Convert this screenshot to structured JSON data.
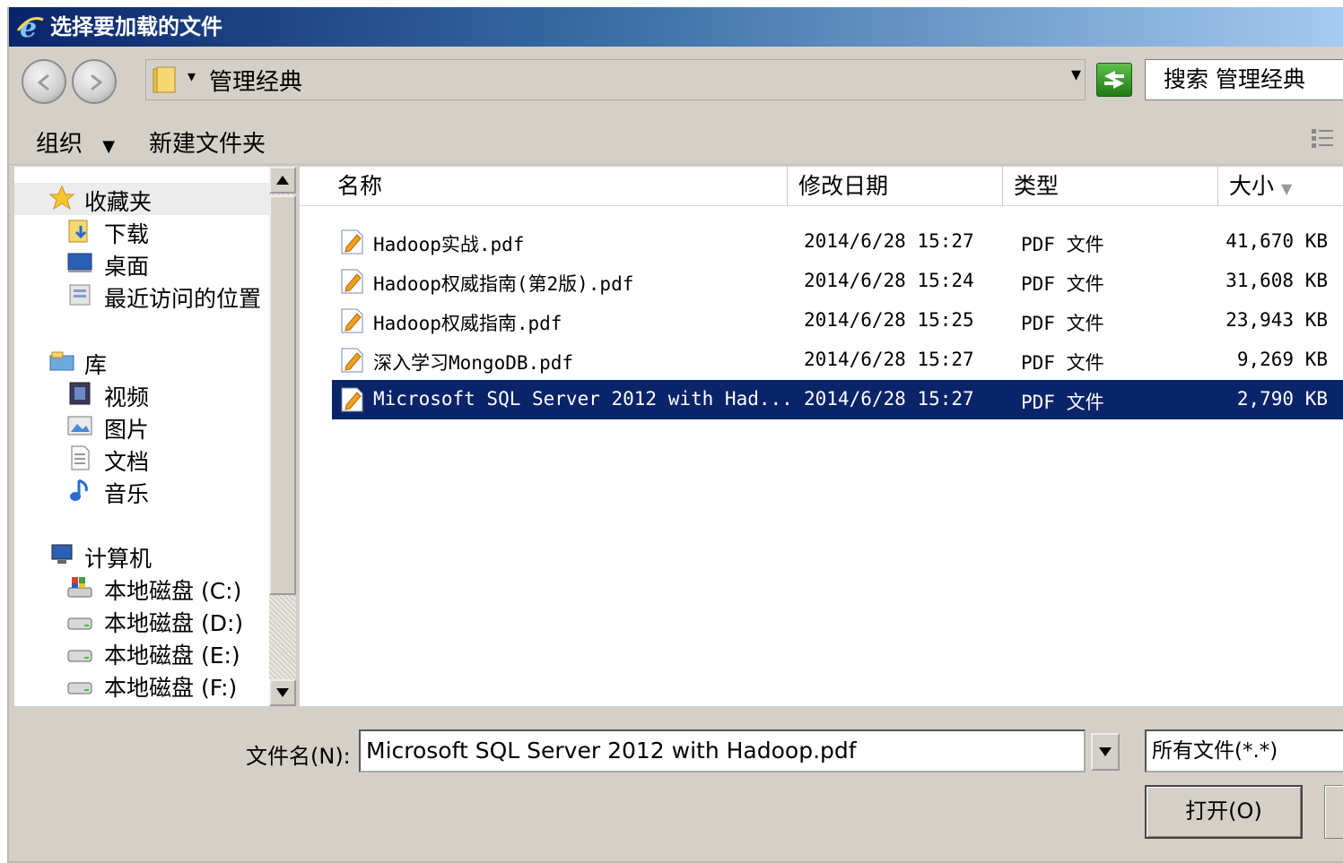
{
  "window": {
    "title": "选择要加载的文件"
  },
  "address": {
    "path": "管理经典",
    "search_placeholder": "搜索 管理经典"
  },
  "toolbar": {
    "organize": "组织",
    "new_folder": "新建文件夹"
  },
  "nav": {
    "favorites": {
      "label": "收藏夹",
      "items": [
        "下载",
        "桌面",
        "最近访问的位置"
      ]
    },
    "libraries": {
      "label": "库",
      "items": [
        "视频",
        "图片",
        "文档",
        "音乐"
      ]
    },
    "computer": {
      "label": "计算机",
      "items": [
        "本地磁盘 (C:)",
        "本地磁盘 (D:)",
        "本地磁盘 (E:)",
        "本地磁盘 (F:)"
      ]
    }
  },
  "columns": {
    "name": "名称",
    "date": "修改日期",
    "type": "类型",
    "size": "大小"
  },
  "files": [
    {
      "name": "Hadoop实战.pdf",
      "date": "2014/6/28 15:27",
      "type": "PDF 文件",
      "size": "41,670 KB"
    },
    {
      "name": "Hadoop权威指南(第2版).pdf",
      "date": "2014/6/28 15:24",
      "type": "PDF 文件",
      "size": "31,608 KB"
    },
    {
      "name": "Hadoop权威指南.pdf",
      "date": "2014/6/28 15:25",
      "type": "PDF 文件",
      "size": "23,943 KB"
    },
    {
      "name": "深入学习MongoDB.pdf",
      "date": "2014/6/28 15:27",
      "type": "PDF 文件",
      "size": "9,269 KB"
    },
    {
      "name": "Microsoft SQL Server 2012 with Had...",
      "date": "2014/6/28 15:27",
      "type": "PDF 文件",
      "size": "2,790 KB",
      "selected": true
    }
  ],
  "bottom": {
    "filename_label": "文件名(N):",
    "filename_value": "Microsoft SQL Server 2012 with Hadoop.pdf",
    "filter": "所有文件(*.*)",
    "open_label": "打开(O)"
  },
  "colors": {
    "selection": "#0a246a",
    "title_start": "#0a246a",
    "title_end": "#a6caf0"
  }
}
